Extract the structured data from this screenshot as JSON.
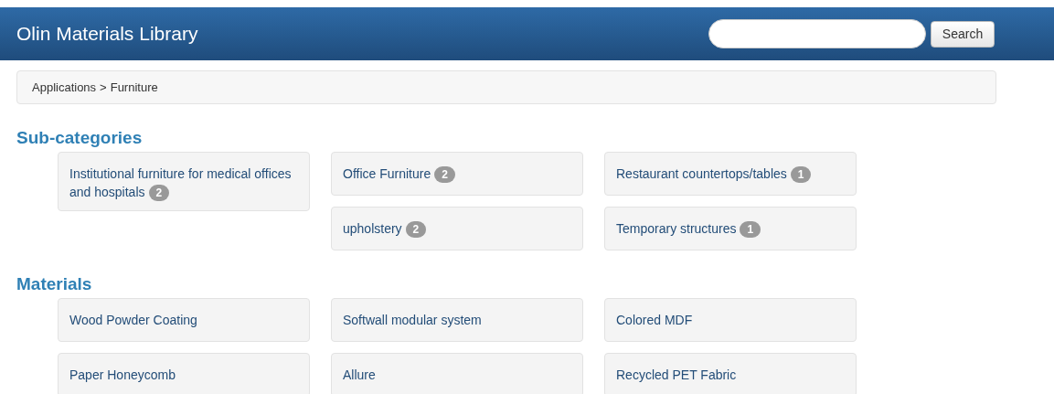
{
  "header": {
    "title": "Olin Materials Library",
    "search": {
      "button": "Search"
    }
  },
  "breadcrumb": {
    "path": "Applications",
    "separator": ">",
    "current": "Furniture"
  },
  "sections": [
    {
      "heading": "Sub-categories",
      "items": [
        {
          "label": "Institutional furniture for medical offices and hospitals",
          "count": "2"
        },
        {
          "label": "Office Furniture",
          "count": "2"
        },
        {
          "label": "Restaurant countertops/tables",
          "count": "1"
        },
        {
          "label": "upholstery",
          "count": "2"
        },
        {
          "label": "Temporary structures",
          "count": "1"
        }
      ]
    },
    {
      "heading": "Materials",
      "items": [
        {
          "label": "Wood Powder Coating"
        },
        {
          "label": "Softwall modular system"
        },
        {
          "label": "Colored MDF"
        },
        {
          "label": "Paper Honeycomb"
        },
        {
          "label": "Allure"
        },
        {
          "label": "Recycled PET Fabric"
        }
      ]
    }
  ]
}
